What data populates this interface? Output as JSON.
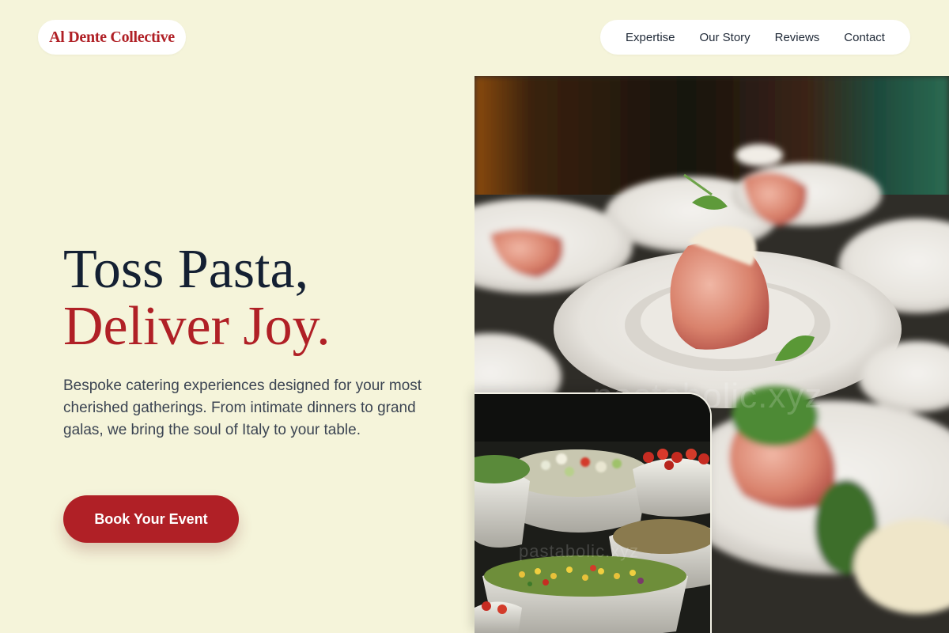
{
  "brand": {
    "name": "Al Dente Collective"
  },
  "nav": {
    "items": [
      {
        "label": "Expertise"
      },
      {
        "label": "Our Story"
      },
      {
        "label": "Reviews"
      },
      {
        "label": "Contact"
      }
    ]
  },
  "hero": {
    "headline_line1": "Toss Pasta,",
    "headline_line2": "Deliver Joy.",
    "description": "Bespoke catering experiences designed for your most cherished gatherings. From intimate dinners to grand galas, we bring the soul of Italy to your table.",
    "cta_label": "Book Your Event"
  },
  "images": {
    "main_watermark": "pastabolic.xyz",
    "inset_watermark": "pastabolic.xyz"
  },
  "colors": {
    "background": "#f5f4da",
    "accent": "#b02026",
    "heading": "#142033"
  }
}
